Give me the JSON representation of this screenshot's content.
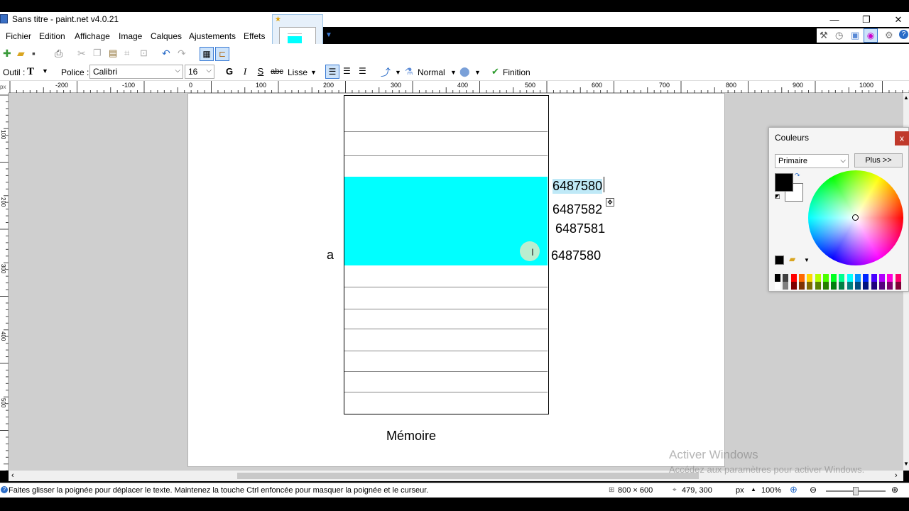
{
  "window": {
    "title": "Sans titre - paint.net v4.0.21",
    "minimize": "—",
    "maximize": "❐",
    "close": "✕"
  },
  "menu": [
    "Fichier",
    "Edition",
    "Affichage",
    "Image",
    "Calques",
    "Ajustements",
    "Effets"
  ],
  "toolbar2": {
    "tool_label": "Outil :",
    "font_label": "Police :",
    "font_value": "Calibri",
    "size_value": "16",
    "bold": "G",
    "italic": "I",
    "strike": "S",
    "outline": "abc",
    "antialias": "Lisse",
    "blend": "Normal",
    "finish": "Finition"
  },
  "ruler": {
    "h_ticks": [
      "-200",
      "-100",
      "0",
      "100",
      "200",
      "300",
      "400",
      "500",
      "600",
      "700",
      "800",
      "900",
      "1000"
    ],
    "v_ticks": [
      "100",
      "200",
      "300",
      "400",
      "500"
    ],
    "corner": "px"
  },
  "canvas": {
    "left_label": "a",
    "values": [
      "6487580",
      "6487582",
      "6487581",
      "6487580"
    ],
    "caption": "Mémoire"
  },
  "colors_panel": {
    "title": "Couleurs",
    "close": "x",
    "mode": "Primaire",
    "more": "Plus >>",
    "accent_cyan": "#00ffff"
  },
  "status": {
    "message": "Faites glisser la poignée pour déplacer le texte. Maintenez la touche Ctrl enfoncée pour masquer la poignée et le curseur.",
    "image_size": "800 × 600",
    "cursor_pos": "479, 300",
    "unit": "px",
    "zoom": "100%"
  },
  "watermark": {
    "line1": "Activer Windows",
    "line2": "Accédez aux paramètres pour activer Windows."
  }
}
